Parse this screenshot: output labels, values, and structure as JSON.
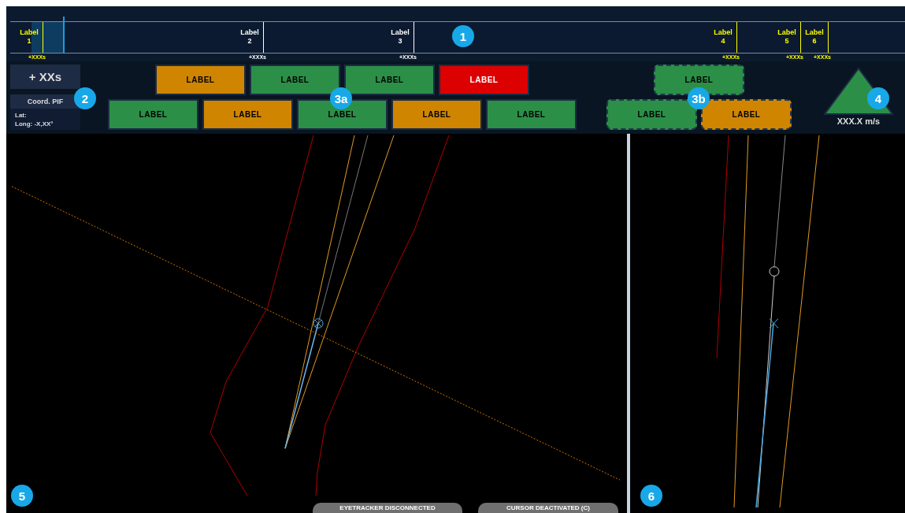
{
  "timeline": {
    "markers": [
      {
        "label": "Label",
        "number": "1",
        "time": "+XXXs",
        "color": "#ffff00",
        "highlighted": true
      },
      {
        "label": "Label",
        "number": "2",
        "time": "+XXXs",
        "color": "#ffffff",
        "highlighted": false
      },
      {
        "label": "Label",
        "number": "3",
        "time": "+XXXs",
        "color": "#ffffff",
        "highlighted": false
      },
      {
        "label": "Label",
        "number": "4",
        "time": "+XXXs",
        "color": "#ffff00",
        "highlighted": false
      },
      {
        "label": "Label",
        "number": "5",
        "time": "+XXXs",
        "color": "#ffff00",
        "highlighted": false
      },
      {
        "label": "Label",
        "number": "6",
        "time": "+XXXs",
        "color": "#ffff00",
        "highlighted": false
      }
    ]
  },
  "info": {
    "time_offset": "+ XXs",
    "coord_title": "Coord. PIF",
    "lat": "Lat:",
    "long": "Long: -X,XX°"
  },
  "button_groups": [
    {
      "kind": "solid",
      "rows": [
        [
          {
            "label": "LABEL",
            "color": "#cf8500"
          },
          {
            "label": "LABEL",
            "color": "#2b8f48"
          },
          {
            "label": "LABEL",
            "color": "#2b8f48"
          },
          {
            "label": "LABEL",
            "color": "#dd0000"
          }
        ],
        [
          {
            "label": "LABEL",
            "color": "#2b8f48"
          },
          {
            "label": "LABEL",
            "color": "#cf8500"
          },
          {
            "label": "LABEL",
            "color": "#2b8f48"
          },
          {
            "label": "LABEL",
            "color": "#cf8500"
          },
          {
            "label": "LABEL",
            "color": "#2b8f48"
          }
        ]
      ]
    },
    {
      "kind": "dashed",
      "rows": [
        [
          {
            "label": "LABEL",
            "color": "#2b8f48"
          }
        ],
        [
          {
            "label": "LABEL",
            "color": "#2b8f48"
          },
          {
            "label": "LABEL",
            "color": "#cf8500"
          }
        ]
      ]
    }
  ],
  "speed": {
    "reading": "XXX.X m/s"
  },
  "status_pills": [
    "EYETRACKER DISCONNECTED",
    "CURSOR DEACTIVATED (C)"
  ],
  "callouts": [
    "1",
    "2",
    "3a",
    "3b",
    "4",
    "5",
    "6"
  ]
}
